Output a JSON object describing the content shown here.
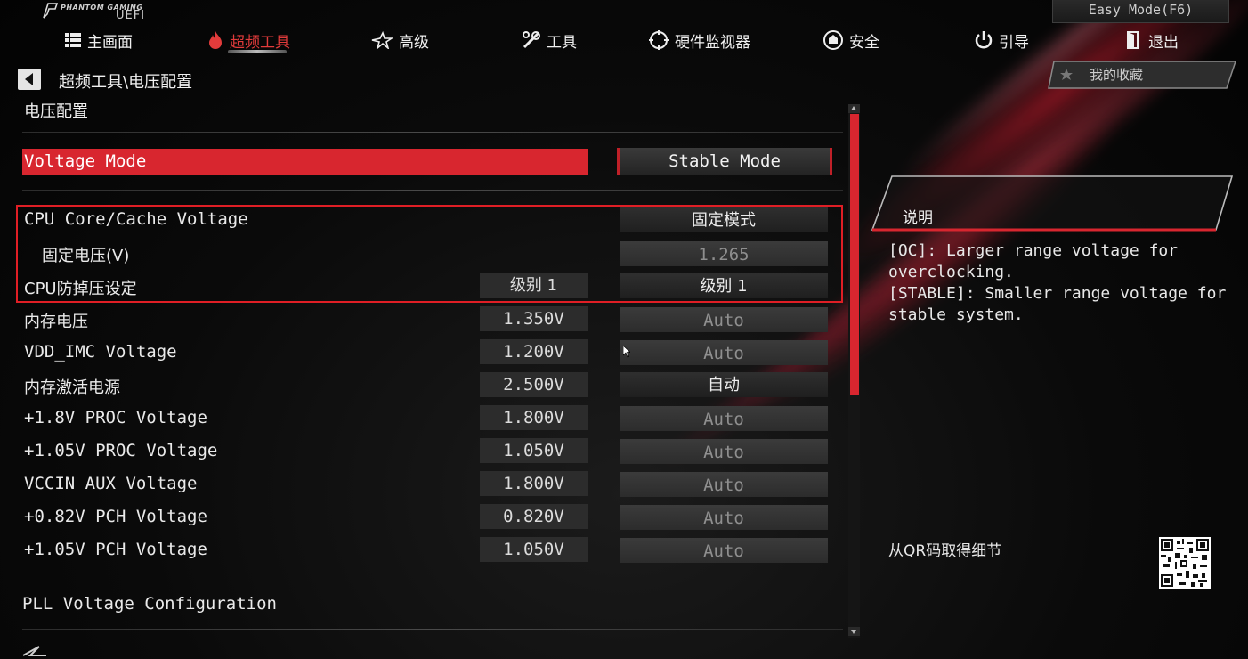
{
  "app": {
    "logo_brand": "PHANTOM GAMING",
    "logo_suffix": "UEFI",
    "easy_mode_button": "Easy Mode(F6)"
  },
  "nav": [
    {
      "label": "主画面",
      "icon": "grid-list-icon"
    },
    {
      "label": "超频工具",
      "icon": "flame-icon",
      "active": true
    },
    {
      "label": "高级",
      "icon": "star-icon"
    },
    {
      "label": "工具",
      "icon": "tools-icon"
    },
    {
      "label": "硬件监视器",
      "icon": "monitor-crosshair-icon"
    },
    {
      "label": "安全",
      "icon": "shield-icon"
    },
    {
      "label": "引导",
      "icon": "power-icon"
    },
    {
      "label": "退出",
      "icon": "exit-door-icon"
    }
  ],
  "breadcrumb": "超频工具\\电压配置",
  "section_title": "电压配置",
  "voltage_mode": {
    "label": "Voltage Mode",
    "value": "Stable Mode"
  },
  "rows": [
    {
      "label": "CPU Core/Cache Voltage",
      "current": "",
      "option": "固定模式",
      "enabled": true
    },
    {
      "label": "固定电压(V)",
      "current": "",
      "option": "1.265",
      "enabled": false
    },
    {
      "label": "CPU防掉压设定",
      "current": "级别 1",
      "option": "级别 1",
      "enabled": true
    },
    {
      "label": "内存电压",
      "current": "1.350V",
      "option": "Auto",
      "enabled": false
    },
    {
      "label": "VDD_IMC Voltage",
      "current": "1.200V",
      "option": "Auto",
      "enabled": false
    },
    {
      "label": "内存激活电源",
      "current": "2.500V",
      "option": "自动",
      "enabled": true
    },
    {
      "label": "+1.8V PROC Voltage",
      "current": "1.800V",
      "option": "Auto",
      "enabled": false
    },
    {
      "label": "+1.05V PROC Voltage",
      "current": "1.050V",
      "option": "Auto",
      "enabled": false
    },
    {
      "label": "VCCIN AUX Voltage",
      "current": "1.800V",
      "option": "Auto",
      "enabled": false
    },
    {
      "label": "+0.82V PCH Voltage",
      "current": "0.820V",
      "option": "Auto",
      "enabled": false
    },
    {
      "label": "+1.05V PCH Voltage",
      "current": "1.050V",
      "option": "Auto",
      "enabled": false
    }
  ],
  "pll_label": "PLL Voltage Configuration",
  "favorites_label": "我的收藏",
  "description": {
    "title": "说明",
    "line1": "[OC]: Larger range voltage for",
    "line2": "overclocking.",
    "line3": "[STABLE]: Smaller range voltage for",
    "line4": "stable system."
  },
  "qr_label": "从QR码取得细节",
  "colors": {
    "accent": "#d8262f",
    "frame": "#e01e25",
    "disabled_text": "#8f8f8f"
  }
}
